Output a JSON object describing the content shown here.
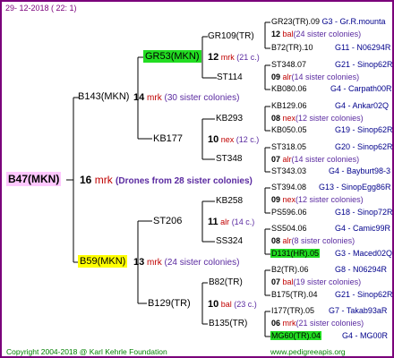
{
  "header": {
    "date": "29- 12-2018 ( 22: 1)"
  },
  "footer": {
    "copyright": "Copyright 2004-2018 @ Karl Kehrle Foundation",
    "site": "www.pedigreeapis.org"
  },
  "colors": {
    "line": "#000000",
    "header": "#7a007a",
    "mark": "#c00000",
    "sister": "#5a2aa0",
    "info": "#00008b",
    "green": "#22dd22",
    "yellow": "#ffff00",
    "pink": "#ffc8ff",
    "footer": "#008000"
  },
  "root": {
    "name": "B47(MKN)",
    "num": "16",
    "mrk": "mrk",
    "note": "(Drones from 28 sister colonies)"
  },
  "gen1": {
    "top": {
      "name": "B143(MKN)",
      "num": "14",
      "mrk": "mrk",
      "note": "(30 sister colonies)"
    },
    "bottom": {
      "name": "B59(MKN)",
      "num": "13",
      "mrk": "mrk",
      "note": "(24 sister colonies)"
    }
  },
  "gen2": {
    "n1": {
      "name": "GR53(MKN)",
      "num": "12",
      "mrk": "mrk",
      "note": "(21 c.)"
    },
    "n2": {
      "name": "KB177",
      "num": "10",
      "mrk": "nex",
      "note": "(12 c.)"
    },
    "n3": {
      "name": "ST206",
      "num": "11",
      "mrk": "alr",
      "note": "(14 c.)"
    },
    "n4": {
      "name": "B129(TR)",
      "num": "10",
      "mrk": "bal",
      "note": "(23 c.)"
    }
  },
  "gen3": {
    "a": {
      "name": "GR109(TR)"
    },
    "b": {
      "name": "ST114"
    },
    "c": {
      "name": "KB293"
    },
    "d": {
      "name": "ST348"
    },
    "e": {
      "name": "KB258"
    },
    "f": {
      "name": "SS324"
    },
    "g": {
      "name": "B82(TR)"
    },
    "h": {
      "name": "B135(TR)"
    }
  },
  "leaves": {
    "l1": {
      "name": "GR23(TR).09",
      "info": "G3 - Gr.R.mounta"
    },
    "s1": {
      "num": "12",
      "mrk": "bal",
      "note": "(24 sister colonies)"
    },
    "l2": {
      "name": "B72(TR).10",
      "info": "G11 - N06294R"
    },
    "l3": {
      "name": "ST348.07",
      "info": "G21 - Sinop62R"
    },
    "s2": {
      "num": "09",
      "mrk": "alr",
      "note": "(14 sister colonies)"
    },
    "l4": {
      "name": "KB080.06",
      "info": "G4 - Carpath00R"
    },
    "l5": {
      "name": "KB129.06",
      "info": "G4 - Ankar02Q"
    },
    "s3": {
      "num": "08",
      "mrk": "nex",
      "note": "(12 sister colonies)"
    },
    "l6": {
      "name": "KB050.05",
      "info": "G19 - Sinop62R"
    },
    "l7": {
      "name": "ST318.05",
      "info": "G20 - Sinop62R"
    },
    "s4": {
      "num": "07",
      "mrk": "alr",
      "note": "(14 sister colonies)"
    },
    "l8": {
      "name": "ST343.03",
      "info": "G4 - Bayburt98-3"
    },
    "l9": {
      "name": "ST394.08",
      "info": "G13 - SinopEgg86R"
    },
    "s5": {
      "num": "09",
      "mrk": "nex",
      "note": "(12 sister colonies)"
    },
    "l10": {
      "name": "PS596.06",
      "info": "G18 - Sinop72R"
    },
    "l11": {
      "name": "SS504.06",
      "info": "G4 - Camic99R"
    },
    "s6": {
      "num": "08",
      "mrk": "alr",
      "note": "(8 sister colonies)"
    },
    "l12": {
      "name": "D131(HR).05",
      "info": "G3 - Maced02Q"
    },
    "l13": {
      "name": "B2(TR).06",
      "info": "G8 - N06294R"
    },
    "s7": {
      "num": "07",
      "mrk": "bal",
      "note": "(19 sister colonies)"
    },
    "l14": {
      "name": "B175(TR).04",
      "info": "G21 - Sinop62R"
    },
    "l15": {
      "name": "I177(TR).05",
      "info": "G7 - Takab93aR"
    },
    "s8": {
      "num": "06",
      "mrk": "mrk",
      "note": "(21 sister colonies)"
    },
    "l16": {
      "name": "MG60(TR).04",
      "info": "G4 - MG00R"
    }
  }
}
